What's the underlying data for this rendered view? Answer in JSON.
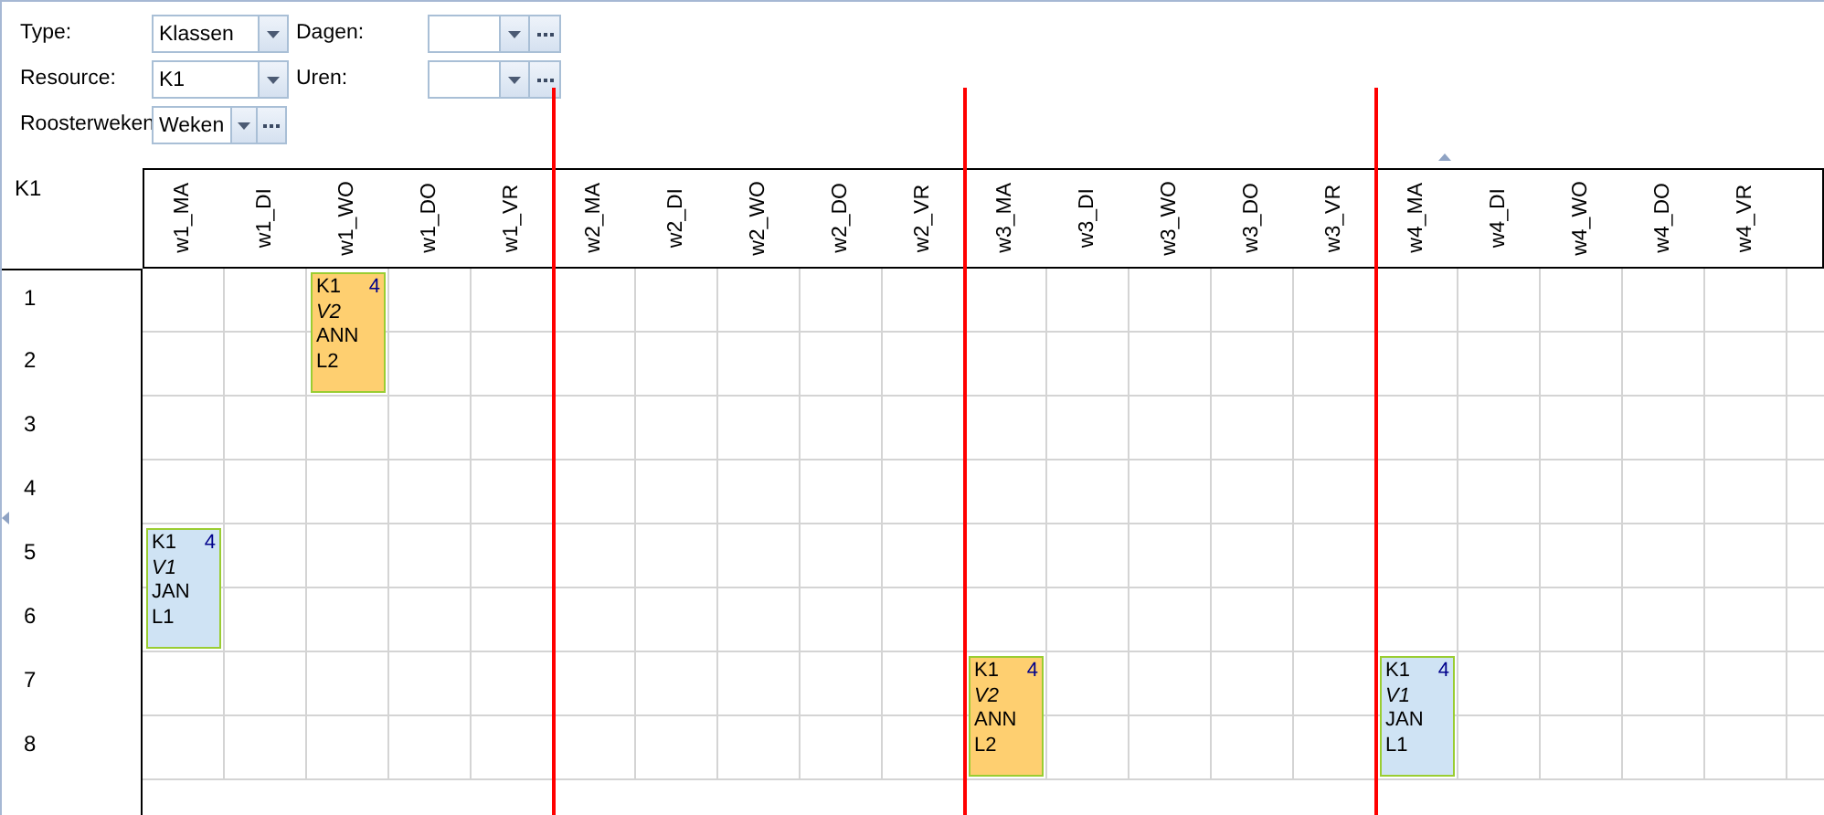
{
  "filters": [
    {
      "label": "Type:",
      "value": "Klassen",
      "kind": "dropdown"
    },
    {
      "label": "Dagen:",
      "kind": "dropdown-ellipsis"
    },
    {
      "label": "Resource:",
      "value": "K1",
      "kind": "dropdown"
    },
    {
      "label": "Uren:",
      "kind": "dropdown-ellipsis"
    },
    {
      "label": "Roosterweken",
      "value": "Weken",
      "kind": "dropdown-ellipsis"
    }
  ],
  "schedule": {
    "resource": "K1",
    "columns": [
      "w1_MA",
      "w1_DI",
      "w1_WO",
      "w1_DO",
      "w1_VR",
      "w2_MA",
      "w2_DI",
      "w2_WO",
      "w2_DO",
      "w2_VR",
      "w3_MA",
      "w3_DI",
      "w3_WO",
      "w3_DO",
      "w3_VR",
      "w4_MA",
      "w4_DI",
      "w4_WO",
      "w4_DO",
      "w4_VR"
    ],
    "periods": [
      {
        "label": "1",
        "cells": [
          null,
          null,
          {
            "class": "K1",
            "count": "4",
            "subject": "V2",
            "teacher": "ANN",
            "room": "L2",
            "color": "#fecf70",
            "double": true
          }
        ]
      },
      {
        "label": "2"
      },
      {
        "label": "3"
      },
      {
        "label": "4"
      },
      {
        "label": "5",
        "cells": [
          {
            "class": "K1",
            "count": "4",
            "subject": "V1",
            "teacher": "JAN",
            "room": "L1",
            "color": "#cfe3f4",
            "double": true
          }
        ]
      },
      {
        "label": "6"
      },
      {
        "label": "7",
        "cells": [
          null,
          null,
          null,
          null,
          null,
          null,
          null,
          null,
          null,
          null,
          {
            "class": "K1",
            "count": "4",
            "subject": "V2",
            "teacher": "ANN",
            "room": "L2",
            "color": "#fecf70",
            "double": true
          },
          null,
          null,
          null,
          null,
          {
            "class": "K1",
            "count": "4",
            "subject": "V1",
            "teacher": "JAN",
            "room": "L1",
            "color": "#cfe3f4",
            "double": true
          }
        ]
      },
      {
        "label": "8"
      }
    ]
  }
}
